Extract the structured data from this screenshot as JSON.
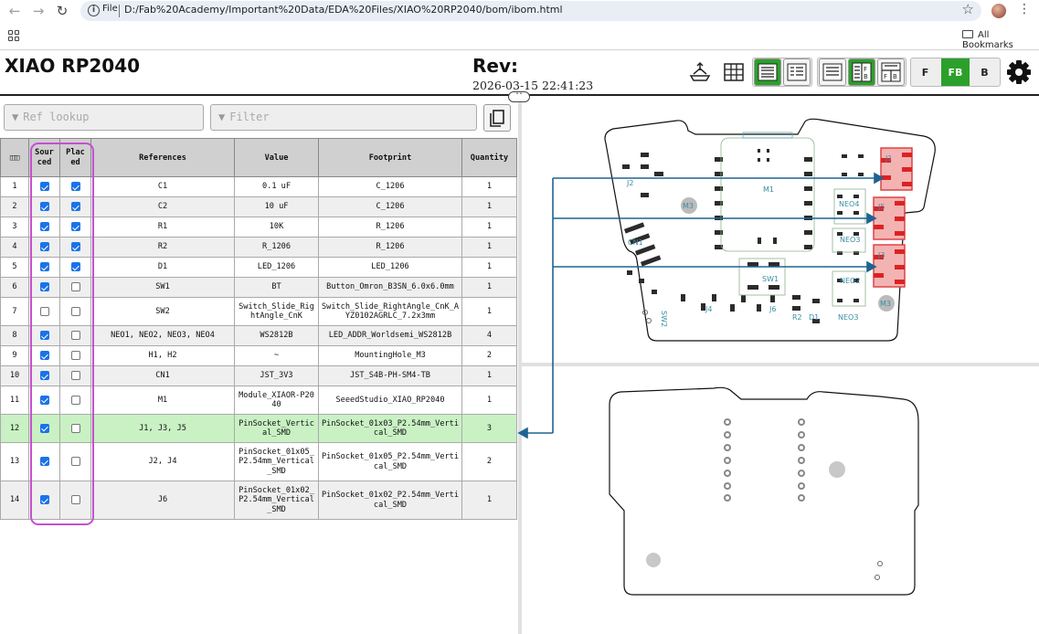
{
  "browser": {
    "file_label": "File",
    "url": "D:/Fab%20Academy/Important%20Data/EDA%20Files/XIAO%20RP2040/bom/ibom.html",
    "bookmarks_label": "All Bookmarks"
  },
  "header": {
    "title": "XIAO RP2040",
    "rev_label": "Rev:",
    "date": "2026-03-15 22:41:23"
  },
  "toolbar": {
    "layer_front": "F",
    "layer_both": "FB",
    "layer_back": "B",
    "active_layer": "FB"
  },
  "search": {
    "ref_placeholder": "Ref lookup",
    "filter_placeholder": "Filter"
  },
  "bom": {
    "columns": {
      "sourced": "Sour ced",
      "placed": "Plac ed",
      "references": "References",
      "value": "Value",
      "footprint": "Footprint",
      "quantity": "Quantity"
    },
    "rows": [
      {
        "n": "1",
        "refs": "C1",
        "value": "0.1 uF",
        "footprint": "C_1206",
        "qty": "1",
        "sourced": true,
        "placed": true
      },
      {
        "n": "2",
        "refs": "C2",
        "value": "10 uF",
        "footprint": "C_1206",
        "qty": "1",
        "sourced": true,
        "placed": true
      },
      {
        "n": "3",
        "refs": "R1",
        "value": "10K",
        "footprint": "R_1206",
        "qty": "1",
        "sourced": true,
        "placed": true
      },
      {
        "n": "4",
        "refs": "R2",
        "value": "R_1206",
        "footprint": "R_1206",
        "qty": "1",
        "sourced": true,
        "placed": true
      },
      {
        "n": "5",
        "refs": "D1",
        "value": "LED_1206",
        "footprint": "LED_1206",
        "qty": "1",
        "sourced": true,
        "placed": true
      },
      {
        "n": "6",
        "refs": "SW1",
        "value": "BT",
        "footprint": "Button_Omron_B3SN_6.0x6.0mm",
        "qty": "1",
        "sourced": true,
        "placed": false
      },
      {
        "n": "7",
        "refs": "SW2",
        "value": "Switch_Slide_RightAngle_CnK",
        "footprint": "Switch_Slide_RightAngle_CnK_AYZ0102AGRLC_7.2x3mm",
        "qty": "1",
        "sourced": false,
        "placed": false
      },
      {
        "n": "8",
        "refs": "NEO1, NEO2, NEO3, NEO4",
        "value": "WS2812B",
        "footprint": "LED_ADDR_Worldsemi_WS2812B",
        "qty": "4",
        "sourced": true,
        "placed": false
      },
      {
        "n": "9",
        "refs": "H1, H2",
        "value": "~",
        "footprint": "MountingHole_M3",
        "qty": "2",
        "sourced": true,
        "placed": false
      },
      {
        "n": "10",
        "refs": "CN1",
        "value": "JST_3V3",
        "footprint": "JST_S4B-PH-SM4-TB",
        "qty": "1",
        "sourced": true,
        "placed": false
      },
      {
        "n": "11",
        "refs": "M1",
        "value": "Module_XIAOR-P2040",
        "footprint": "SeeedStudio_XIAO_RP2040",
        "qty": "1",
        "sourced": true,
        "placed": false
      },
      {
        "n": "12",
        "refs": "J1, J3, J5",
        "value": "PinSocket_Vertical_SMD",
        "footprint": "PinSocket_01x03_P2.54mm_Vertical_SMD",
        "qty": "3",
        "sourced": true,
        "placed": false
      },
      {
        "n": "13",
        "refs": "J2, J4",
        "value": "PinSocket_01x05_P2.54mm_Vertical_SMD",
        "footprint": "PinSocket_01x05_P2.54mm_Vertical_SMD",
        "qty": "2",
        "sourced": true,
        "placed": false
      },
      {
        "n": "14",
        "refs": "J6",
        "value": "PinSocket_01x02_P2.54mm_Vertical_SMD",
        "footprint": "PinSocket_01x02_P2.54mm_Vertical_SMD",
        "qty": "1",
        "sourced": true,
        "placed": false
      }
    ],
    "highlighted_row": "12"
  },
  "pcb": {
    "front_labels": [
      "J1",
      "J5",
      "J3",
      "J2",
      "M1",
      "M3",
      "NEO4",
      "NEO3",
      "NEO2",
      "NEO3",
      "CN1",
      "SW1",
      "SW2",
      "J4",
      "J6",
      "R2",
      "D1",
      "M3"
    ],
    "highlight_color": "#e05252",
    "arrow_color": "#1f6391"
  },
  "colors": {
    "toolbar_active": "#2ba02b",
    "highlight_row": "#c9f1c4",
    "annotation": "#c64fd0"
  }
}
